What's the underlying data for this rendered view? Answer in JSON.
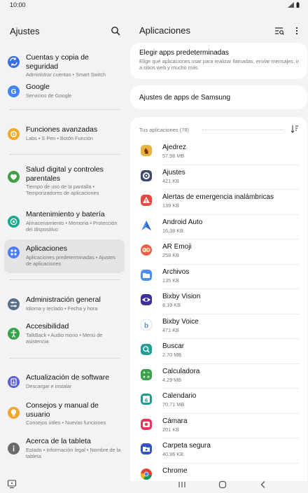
{
  "status": {
    "time": "10:00"
  },
  "left": {
    "title": "Ajustes",
    "items": [
      {
        "title": "Cuentas y copia de seguridad",
        "sub": "Administrar cuentas  •  Smart Switch",
        "icon": "sync-icon",
        "color": "#3b6fe0"
      },
      {
        "title": "Google",
        "sub": "Servicios de Google",
        "icon": "google-icon",
        "color": "#4285f4"
      },
      {
        "title": "Funciones avanzadas",
        "sub": "Labs  •  S Pen  •  Botón Función",
        "icon": "gear-plus-icon",
        "color": "#f0a92b"
      },
      {
        "title": "Salud digital y controles parentales",
        "sub": "Tiempo de uso de la pantalla  •  Temporizadores de aplicaciones",
        "icon": "wellbeing-icon",
        "color": "#43a047"
      },
      {
        "title": "Mantenimiento y batería",
        "sub": "Almacenamiento  •  Memoria  •  Protección del dispositivo",
        "icon": "maintenance-icon",
        "color": "#17a88f"
      },
      {
        "title": "Aplicaciones",
        "sub": "Aplicaciones predeterminadas  •  Ajustes de aplicaciones",
        "icon": "apps-icon",
        "color": "#4f7cf1"
      },
      {
        "title": "Administración general",
        "sub": "Idioma y teclado  •  Fecha y hora",
        "icon": "sliders-icon",
        "color": "#5a6f8a"
      },
      {
        "title": "Accesibilidad",
        "sub": "TalkBack  •  Audio mono  •  Menú de asistencia",
        "icon": "accessibility-icon",
        "color": "#3aa34a"
      },
      {
        "title": "Actualización de software",
        "sub": "Descargar e instalar",
        "icon": "update-icon",
        "color": "#5b5fd6"
      },
      {
        "title": "Consejos y manual de usuario",
        "sub": "Consejos útiles  •  Nuevas funciones",
        "icon": "tips-icon",
        "color": "#f3a52b"
      },
      {
        "title": "Acerca de la tableta",
        "sub": "Estado  •  Información legal  •  Nombre de la tableta",
        "icon": "info-icon",
        "color": "#6b6b6b"
      }
    ]
  },
  "right": {
    "title": "Aplicaciones",
    "default_apps": {
      "title": "Elegir apps predeterminadas",
      "sub": "Elige qué aplicaciones usar para realizar llamadas, enviar mensajes, ir a sitios web y mucho más."
    },
    "samsung_settings": {
      "title": "Ajustes de apps de Samsung"
    },
    "apps_header": "Tus aplicaciones (78)",
    "apps": [
      {
        "name": "Ajedrez",
        "size": "57,98 MB",
        "icon": "chess-icon",
        "color": "#d9a334"
      },
      {
        "name": "Ajustes",
        "size": "421 KB",
        "icon": "settings-icon",
        "color": "#3d4a6b"
      },
      {
        "name": "Alertas de emergencia inalámbricas",
        "size": "139 KB",
        "icon": "alert-icon",
        "color": "#e5493f"
      },
      {
        "name": "Android Auto",
        "size": "16,38 KB",
        "icon": "android-auto-icon",
        "color": "#ffffff"
      },
      {
        "name": "AR Emoji",
        "size": "258 KB",
        "icon": "ar-emoji-icon",
        "color": "#e8604c"
      },
      {
        "name": "Archivos",
        "size": "135 KB",
        "icon": "folder-icon",
        "color": "#4c8ef7"
      },
      {
        "name": "Bixby Vision",
        "size": "8,19 KB",
        "icon": "eye-icon",
        "color": "#3b2f9a"
      },
      {
        "name": "Bixby Voice",
        "size": "471 KB",
        "icon": "bixby-icon",
        "color": "#4a8ff0"
      },
      {
        "name": "Buscar",
        "size": "2,70 MB",
        "icon": "finder-icon",
        "color": "#1e9e94"
      },
      {
        "name": "Calculadora",
        "size": "4,29 MB",
        "icon": "calculator-icon",
        "color": "#3aa34a"
      },
      {
        "name": "Calendario",
        "size": "70,71 MB",
        "icon": "calendar-icon",
        "color": "#1a9c8c"
      },
      {
        "name": "Cámara",
        "size": "201 KB",
        "icon": "camera-icon",
        "color": "#e8365a"
      },
      {
        "name": "Carpeta segura",
        "size": "40,96 KB",
        "icon": "secure-folder-icon",
        "color": "#2f56c6"
      },
      {
        "name": "Chrome",
        "size": "",
        "icon": "chrome-icon",
        "color": "#ffffff"
      }
    ]
  }
}
